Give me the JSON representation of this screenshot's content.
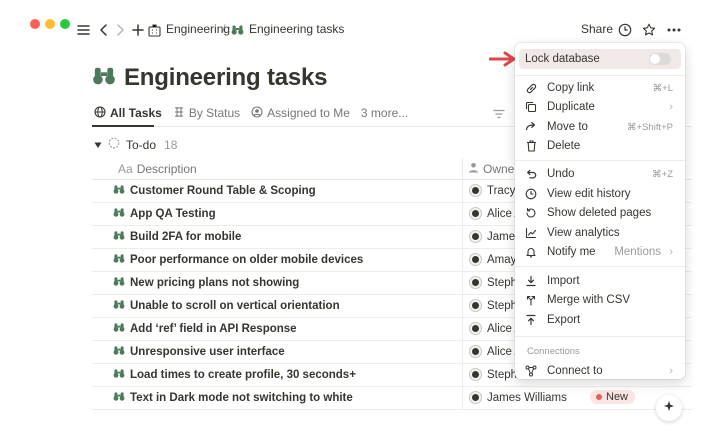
{
  "topbar": {
    "breadcrumb_parent": "Engineering",
    "breadcrumb_sep": "/",
    "breadcrumb_current": "Engineering tasks",
    "share_label": "Share"
  },
  "page": {
    "title": "Engineering tasks",
    "title_icon": "binoculars-icon"
  },
  "views": [
    {
      "label": "All Tasks",
      "icon": "globe-icon",
      "active": true
    },
    {
      "label": "By Status",
      "icon": "status-icon",
      "active": false
    },
    {
      "label": "Assigned to Me",
      "icon": "person-icon",
      "active": false
    },
    {
      "label": "3 more...",
      "icon": "",
      "active": false
    }
  ],
  "group": {
    "label": "To-do",
    "count": "18"
  },
  "columns": {
    "description_prefix": "Aa",
    "description": "Description",
    "owner": "Owner"
  },
  "rows": [
    {
      "name": "Customer Round Table & Scoping",
      "owner": "Tracy C"
    },
    {
      "name": "App QA Testing",
      "owner": "Alice A"
    },
    {
      "name": "Build 2FA for mobile",
      "owner": "James"
    },
    {
      "name": "Poor performance on older mobile devices",
      "owner": "Amaya"
    },
    {
      "name": "New pricing plans not showing",
      "owner": "Stepha"
    },
    {
      "name": "Unable to scroll on vertical orientation",
      "owner": "Stepha"
    },
    {
      "name": "Add ‘ref’ field in API Response",
      "owner": "Alice A"
    },
    {
      "name": "Unresponsive user interface",
      "owner": "Alice A"
    },
    {
      "name": "Load times to create profile, 30 seconds+",
      "owner": "Stepha"
    },
    {
      "name": "Text in Dark mode not switching to white",
      "owner": "James Williams",
      "status": "New"
    }
  ],
  "menu": {
    "lock_label": "Lock database",
    "items": {
      "copy_link": {
        "label": "Copy link",
        "shortcut": "⌘+L"
      },
      "duplicate": {
        "label": "Duplicate"
      },
      "move_to": {
        "label": "Move to",
        "shortcut": "⌘+Shift+P"
      },
      "delete": {
        "label": "Delete"
      },
      "undo": {
        "label": "Undo",
        "shortcut": "⌘+Z"
      },
      "view_edit_history": {
        "label": "View edit history"
      },
      "show_deleted_pages": {
        "label": "Show deleted pages"
      },
      "view_analytics": {
        "label": "View analytics"
      },
      "notify_me": {
        "label": "Notify me",
        "value": "Mentions"
      },
      "import": {
        "label": "Import"
      },
      "merge_with_csv": {
        "label": "Merge with CSV"
      },
      "export": {
        "label": "Export"
      },
      "connections_header": "Connections",
      "connect_to": {
        "label": "Connect to"
      }
    }
  },
  "colors": {
    "accent_arrow": "#e0464a",
    "status_new_bg": "#fbe4e4",
    "status_new_dot": "#e16259",
    "lock_highlight": "#f0e9e8"
  }
}
